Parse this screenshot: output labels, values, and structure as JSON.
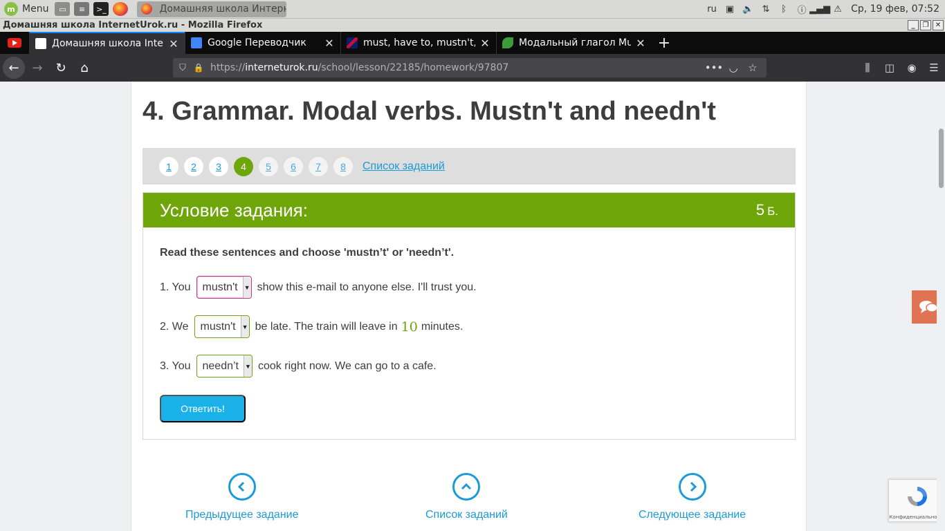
{
  "os": {
    "menu_label": "Menu",
    "mint_glyph": "m",
    "task_title": "Домашняя школа Интерне…",
    "layout": "ru",
    "clock": "Ср, 19 фев, 07:52"
  },
  "window": {
    "title": "Домашняя школа InternetUrok.ru - Mozilla Firefox"
  },
  "tabs": [
    {
      "label": "Домашняя школа Interne",
      "icon": "play-favicon",
      "color": "#4a90d9"
    },
    {
      "label": "Google Переводчик",
      "icon": "google-translate-favicon",
      "color": "#4285f4"
    },
    {
      "label": "must, have to, mustn't, ne",
      "icon": "uk-flag-favicon",
      "color": "#c8102e"
    },
    {
      "label": "Модальный глагол Must",
      "icon": "leaf-favicon",
      "color": "#3c9c3c"
    }
  ],
  "urlbar": {
    "prefix": "https://",
    "host": "interneturok.ru",
    "path": "/school/lesson/22185/homework/97807"
  },
  "page": {
    "title": "4. Grammar. Modal verbs. Mustn't and needn't",
    "task_numbers": [
      "1",
      "2",
      "3",
      "4",
      "5",
      "6",
      "7",
      "8"
    ],
    "current_task": "4",
    "task_list_link": "Список заданий",
    "task_header": "Условие задания:",
    "points": "5",
    "points_unit": "Б.",
    "instruction": "Read these sentences and choose 'mustn’t' or 'needn’t'.",
    "sentences": [
      {
        "before": "1. You",
        "selected": "mustn't",
        "after": "show this e-mail to anyone else. I'll trust you."
      },
      {
        "before": "2. We",
        "selected": "mustn't",
        "after_a": "be late. The train will leave in",
        "number": "10",
        "after_b": "minutes."
      },
      {
        "before": "3. You",
        "selected": "needn’t",
        "after": "cook right now. We can go to a cafe."
      }
    ],
    "submit_label": "Ответить!",
    "prev_label": "Предыдущее задание",
    "list_label": "Список заданий",
    "next_label": "Следующее задание",
    "recaptcha_text": "Конфиденциальность"
  },
  "colors": {
    "accent_green": "#6ea60a",
    "link_blue": "#1a9ad6",
    "button_blue": "#1ab0e8",
    "chat_orange": "#e07352"
  }
}
